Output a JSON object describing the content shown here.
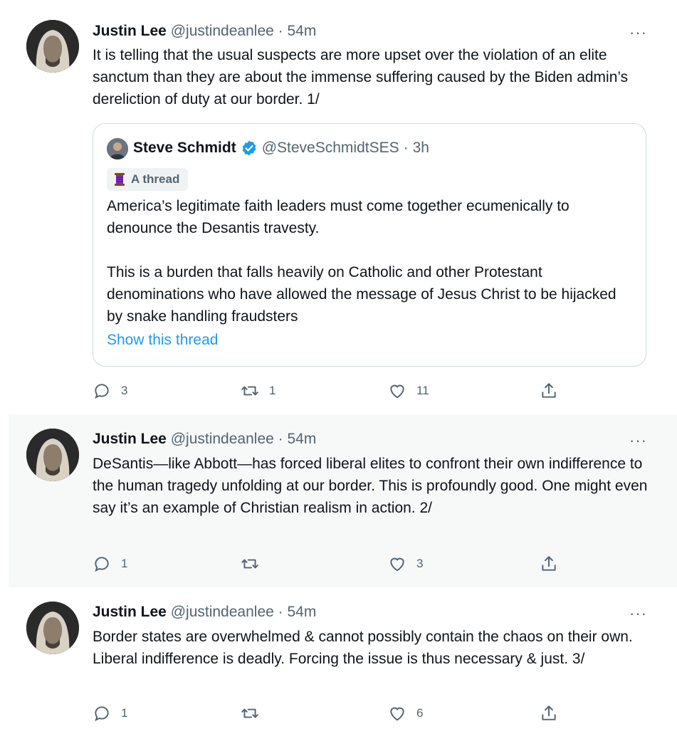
{
  "tweets": [
    {
      "author": {
        "name": "Justin Lee",
        "handle": "@justindeanlee",
        "time": "54m"
      },
      "dot": "·",
      "more": "···",
      "text": "It is telling that the usual suspects are more upset over the violation of an elite sanctum than they are about the immense suffering caused by the Biden admin’s dereliction of duty at our border. 1/",
      "quoted": {
        "author": {
          "name": "Steve Schmidt",
          "handle": "@SteveSchmidtSES",
          "time": "3h",
          "verified": true
        },
        "badge": "A thread",
        "paragraphs": [
          "America’s legitimate faith leaders must come together ecumenically to denounce the Desantis travesty.",
          "This is a burden that falls heavily on Catholic and other Protestant denominations who have allowed the message of Jesus Christ to be hijacked by snake handling fraudsters"
        ],
        "show_thread": "Show this thread"
      },
      "actions": {
        "reply": "3",
        "retweet": "1",
        "like": "11",
        "share": ""
      }
    },
    {
      "author": {
        "name": "Justin Lee",
        "handle": "@justindeanlee",
        "time": "54m"
      },
      "dot": "·",
      "more": "···",
      "text": "DeSantis—like Abbott—has forced liberal elites to confront their own indifference to the human tragedy unfolding at our border. This is profoundly good. One might even say it’s an example of Christian realism in action. 2/",
      "actions": {
        "reply": "1",
        "retweet": "",
        "like": "3",
        "share": ""
      }
    },
    {
      "author": {
        "name": "Justin Lee",
        "handle": "@justindeanlee",
        "time": "54m"
      },
      "dot": "·",
      "more": "···",
      "text": "Border states are overwhelmed & cannot possibly contain the chaos on their own. Liberal indifference is deadly. Forcing the issue is thus necessary & just. 3/",
      "actions": {
        "reply": "1",
        "retweet": "",
        "like": "6",
        "share": ""
      }
    }
  ],
  "colors": {
    "accent": "#1d9bf0",
    "muted": "#536471",
    "text": "#0f1419",
    "border": "#cfd9de",
    "hover_bg": "#f7f9f9"
  },
  "icons": [
    "reply-icon",
    "retweet-icon",
    "like-icon",
    "share-icon",
    "more-icon",
    "verified-badge-icon",
    "thread-spool-icon"
  ]
}
